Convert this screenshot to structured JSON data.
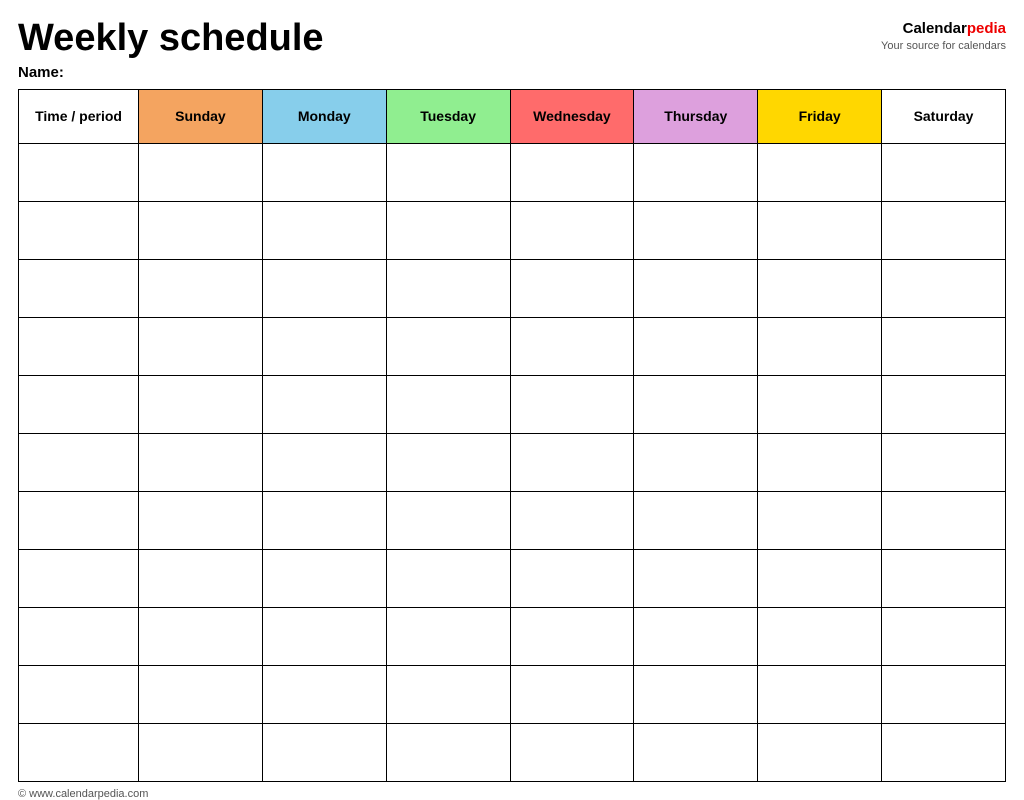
{
  "header": {
    "title": "Weekly schedule",
    "name_label": "Name:",
    "brand_calendar": "Calendar",
    "brand_pedia": "pedia",
    "brand_tagline": "Your source for calendars"
  },
  "table": {
    "columns": [
      {
        "key": "time",
        "label": "Time / period",
        "class": "col-time"
      },
      {
        "key": "sunday",
        "label": "Sunday",
        "class": "col-sunday"
      },
      {
        "key": "monday",
        "label": "Monday",
        "class": "col-monday"
      },
      {
        "key": "tuesday",
        "label": "Tuesday",
        "class": "col-tuesday"
      },
      {
        "key": "wednesday",
        "label": "Wednesday",
        "class": "col-wednesday"
      },
      {
        "key": "thursday",
        "label": "Thursday",
        "class": "col-thursday"
      },
      {
        "key": "friday",
        "label": "Friday",
        "class": "col-friday"
      },
      {
        "key": "saturday",
        "label": "Saturday",
        "class": "col-saturday"
      }
    ],
    "row_count": 11
  },
  "footer": {
    "url": "© www.calendarpedia.com"
  }
}
